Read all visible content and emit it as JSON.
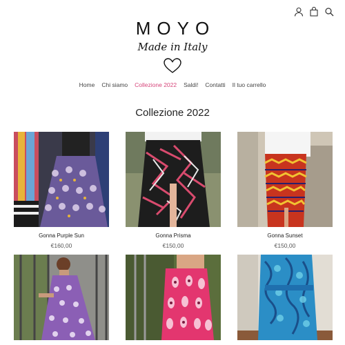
{
  "header": {
    "brand": "MOYO",
    "tagline": "Made in Italy",
    "icons": [
      "user-icon",
      "bag-icon",
      "search-icon"
    ]
  },
  "nav": {
    "items": [
      {
        "label": "Home"
      },
      {
        "label": "Chi siamo"
      },
      {
        "label": "Collezione 2022",
        "active": true
      },
      {
        "label": "Saldi!"
      },
      {
        "label": "Contatti"
      },
      {
        "label": "Il tuo carrello"
      }
    ]
  },
  "page": {
    "title": "Collezione 2022"
  },
  "products": [
    {
      "name": "Gonna Purple Sun",
      "price": "€160,00"
    },
    {
      "name": "Gonna Prisma",
      "price": "€150,00"
    },
    {
      "name": "Gonna Sunset",
      "price": "€150,00"
    },
    {
      "name": "",
      "price": ""
    },
    {
      "name": "",
      "price": ""
    },
    {
      "name": "",
      "price": ""
    }
  ],
  "colors": {
    "accent": "#d6457a",
    "text": "#222222"
  }
}
